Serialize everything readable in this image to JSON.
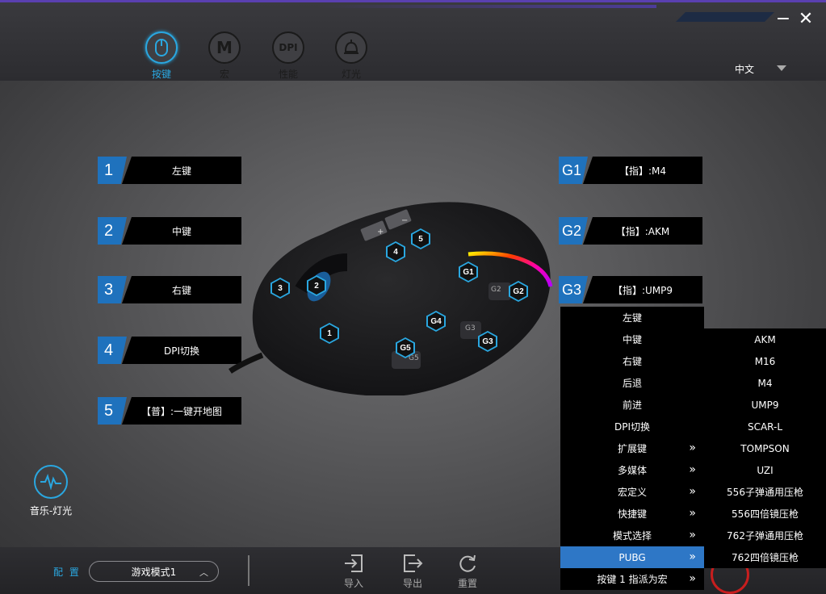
{
  "window": {
    "minimize_label": "−",
    "close_label": "✕"
  },
  "nav": {
    "tabs": [
      {
        "label": "按键",
        "icon": "mouse-icon",
        "active": true
      },
      {
        "label": "宏",
        "icon": "M",
        "active": false
      },
      {
        "label": "性能",
        "icon": "DPI",
        "active": false
      },
      {
        "label": "灯光",
        "icon": "bell-light-icon",
        "active": false
      }
    ]
  },
  "language": {
    "value": "中文"
  },
  "left_keys": [
    {
      "num": "1",
      "value": "左键"
    },
    {
      "num": "2",
      "value": "中键"
    },
    {
      "num": "3",
      "value": "右键"
    },
    {
      "num": "4",
      "value": "DPI切换"
    },
    {
      "num": "5",
      "value": "【普】:一键开地图"
    }
  ],
  "right_keys": [
    {
      "num": "G1",
      "value": "【指】:M4"
    },
    {
      "num": "G2",
      "value": "【指】:AKM"
    },
    {
      "num": "G3",
      "value": "【指】:UMP9"
    }
  ],
  "mouse_markers": [
    "1",
    "2",
    "3",
    "4",
    "5",
    "G1",
    "G2",
    "G3",
    "G4",
    "G5"
  ],
  "mouse_button_labels": {
    "plus": "+",
    "minus": "−",
    "g2": "G2",
    "g3": "G3",
    "g5": "G5"
  },
  "music_light": {
    "label": "音乐-灯光"
  },
  "bottom": {
    "config_label": "配 置",
    "config_value": "游戏模式1",
    "import_label": "导入",
    "export_label": "导出",
    "reset_label": "重置"
  },
  "menu": {
    "items": [
      {
        "label": "左键",
        "has_sub": false
      },
      {
        "label": "中键",
        "has_sub": false
      },
      {
        "label": "右键",
        "has_sub": false
      },
      {
        "label": "后退",
        "has_sub": false
      },
      {
        "label": "前进",
        "has_sub": false
      },
      {
        "label": "DPI切换",
        "has_sub": false
      },
      {
        "label": "扩展键",
        "has_sub": true
      },
      {
        "label": "多媒体",
        "has_sub": true
      },
      {
        "label": "宏定义",
        "has_sub": true
      },
      {
        "label": "快捷键",
        "has_sub": true
      },
      {
        "label": "模式选择",
        "has_sub": true
      },
      {
        "label": "PUBG",
        "has_sub": true,
        "active": true
      },
      {
        "label": "按键 1 指派为宏",
        "has_sub": true
      }
    ],
    "arrow": "»"
  },
  "submenu": {
    "items": [
      "AKM",
      "M16",
      "M4",
      "UMP9",
      "SCAR-L",
      "TOMPSON",
      "UZI",
      "556子弹通用压枪",
      "556四倍镜压枪",
      "762子弹通用压枪",
      "762四倍镜压枪"
    ]
  },
  "colors": {
    "accent": "#2aa7e0",
    "key_number_bg": "#1f72bd",
    "menu_active": "#2e77c6"
  }
}
